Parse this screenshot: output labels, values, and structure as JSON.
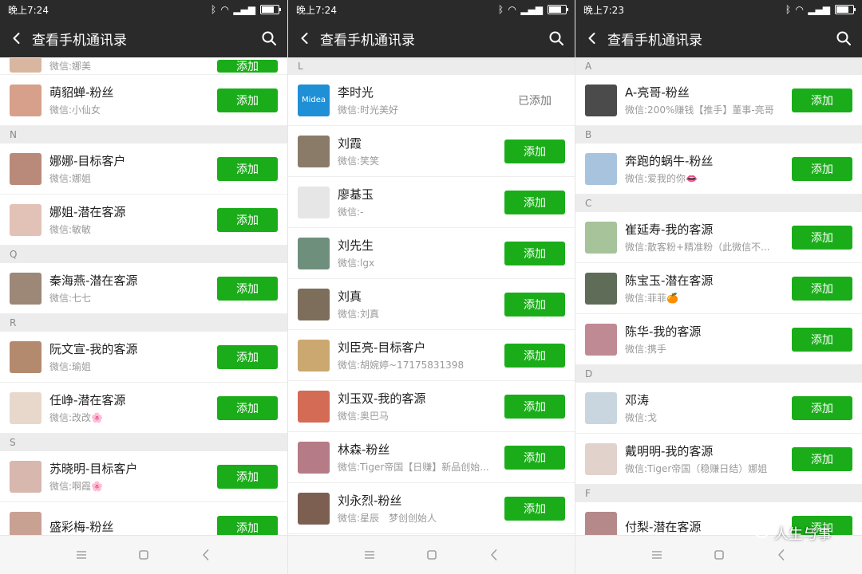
{
  "panels": [
    {
      "time": "晚上7:24",
      "title": "查看手机通讯录",
      "sections": [
        {
          "letter": "",
          "rows": [
            {
              "name": "",
              "wx": "微信:娜美",
              "partial": true,
              "btn": "添加",
              "avatar_color": "#d9b6a0"
            }
          ]
        },
        {
          "letter": "",
          "rows": [
            {
              "name": "萌貂蝉-粉丝",
              "wx": "微信:小仙女",
              "btn": "添加",
              "avatar_color": "#d6a08a"
            }
          ]
        },
        {
          "letter": "N",
          "rows": [
            {
              "name": "娜娜-目标客户",
              "wx": "微信:娜姐",
              "btn": "添加",
              "avatar_color": "#b98a7a"
            },
            {
              "name": "娜姐-潜在客源",
              "wx": "微信:敏敏",
              "btn": "添加",
              "avatar_color": "#e2c2b6"
            }
          ]
        },
        {
          "letter": "Q",
          "rows": [
            {
              "name": "秦海燕-潜在客源",
              "wx": "微信:七七",
              "btn": "添加",
              "avatar_color": "#9d8776"
            }
          ]
        },
        {
          "letter": "R",
          "rows": [
            {
              "name": "阮文宣-我的客源",
              "wx": "微信:瑜姐",
              "btn": "添加",
              "avatar_color": "#b48a6e"
            },
            {
              "name": "任峥-潜在客源",
              "wx": "微信:改改🌸",
              "btn": "添加",
              "avatar_color": "#e8d8cc"
            }
          ]
        },
        {
          "letter": "S",
          "rows": [
            {
              "name": "苏晓明-目标客户",
              "wx": "微信:啊霞🌸",
              "btn": "添加",
              "avatar_color": "#d8b7ae"
            },
            {
              "name": "盛彩梅-粉丝",
              "wx": "",
              "btn": "添加",
              "avatar_color": "#c9a193"
            }
          ]
        }
      ]
    },
    {
      "time": "晚上7:24",
      "title": "查看手机通讯录",
      "sections": [
        {
          "letter": "L",
          "rows": [
            {
              "name": "李时光",
              "wx": "微信:时光美好",
              "added": "已添加",
              "avatar_color": "#1f8fd6",
              "avatar_text": "Midea"
            },
            {
              "name": "刘霞",
              "wx": "微信:笑笑",
              "btn": "添加",
              "avatar_color": "#8a7b69"
            },
            {
              "name": "廖基玉",
              "wx": "微信:-",
              "btn": "添加",
              "avatar_color": "#e6e6e6"
            },
            {
              "name": "刘先生",
              "wx": "微信:lgx",
              "btn": "添加",
              "avatar_color": "#6f8f7d"
            },
            {
              "name": "刘真",
              "wx": "微信:刘真",
              "btn": "添加",
              "avatar_color": "#7d6d5b"
            },
            {
              "name": "刘臣亮-目标客户",
              "wx": "微信:胡婉婷~17175831398",
              "btn": "添加",
              "avatar_color": "#caa86f"
            },
            {
              "name": "刘玉双-我的客源",
              "wx": "微信:奥巴马",
              "btn": "添加",
              "avatar_color": "#d36b55"
            },
            {
              "name": "林森-粉丝",
              "wx": "微信:Tiger帝国【日赚】新品创始...",
              "btn": "添加",
              "avatar_color": "#b57b86"
            },
            {
              "name": "刘永烈-粉丝",
              "wx": "微信:星辰　梦创创始人",
              "btn": "添加",
              "avatar_color": "#7d5f52"
            }
          ]
        }
      ]
    },
    {
      "time": "晚上7:23",
      "title": "查看手机通讯录",
      "sections": [
        {
          "letter": "A",
          "rows": [
            {
              "name": "A-亮哥-粉丝",
              "wx": "微信:200%赚钱【推手】董事-亮哥",
              "btn": "添加",
              "avatar_color": "#4b4b4b"
            }
          ]
        },
        {
          "letter": "B",
          "rows": [
            {
              "name": "奔跑的蜗牛-粉丝",
              "wx": "微信:爱我的你👄",
              "btn": "添加",
              "avatar_color": "#a7c3de"
            }
          ]
        },
        {
          "letter": "C",
          "rows": [
            {
              "name": "崔延寿-我的客源",
              "wx": "微信:散客粉+精准粉（此微信不...",
              "btn": "添加",
              "avatar_color": "#a6c39a"
            },
            {
              "name": "陈宝玉-潜在客源",
              "wx": "微信:菲菲🍊",
              "btn": "添加",
              "avatar_color": "#5f6d58"
            },
            {
              "name": "陈华-我的客源",
              "wx": "微信:携手",
              "btn": "添加",
              "avatar_color": "#c08a95"
            }
          ]
        },
        {
          "letter": "D",
          "rows": [
            {
              "name": "邓涛",
              "wx": "微信:戈",
              "btn": "添加",
              "avatar_color": "#c9d6df"
            },
            {
              "name": "戴明明-我的客源",
              "wx": "微信:Tiger帝国（稳赚日结）娜姐",
              "btn": "添加",
              "avatar_color": "#e2d2cc"
            }
          ]
        },
        {
          "letter": "F",
          "rows": [
            {
              "name": "付梨-潜在客源",
              "wx": "",
              "btn": "添加",
              "avatar_color": "#b5898a"
            }
          ]
        }
      ]
    }
  ],
  "watermark": "人生与事"
}
